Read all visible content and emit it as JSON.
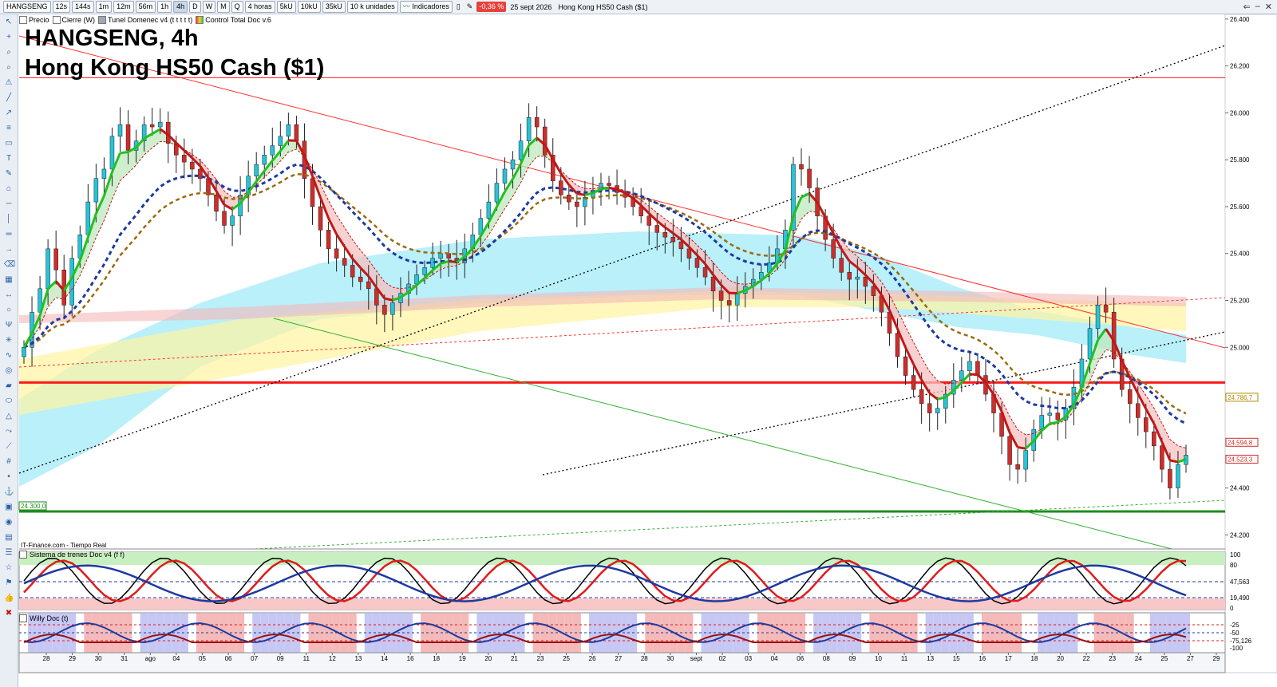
{
  "toolbar": {
    "symbol": "HANGSENG",
    "timeframes": [
      "12s",
      "144s",
      "1m",
      "12m",
      "56m",
      "1h",
      "4h",
      "D",
      "W",
      "M",
      "Q"
    ],
    "active_timeframe": "4h",
    "period": "4 horas",
    "vol_buttons": [
      "5kU",
      "10kU",
      "35kU"
    ],
    "units": "10 k unidades",
    "indicators": "Indicadores",
    "change_pct": "-0,36 %",
    "date": "25 sept 2026",
    "instrument": "Hong Kong HS50 Cash ($1)"
  },
  "subtoolbar": [
    "Precio",
    "Cierre (W)",
    "Tunel Domenec v4 (t t t t t)",
    "Control Total Doc v.6"
  ],
  "titles": {
    "line1": "HANGSENG, 4h",
    "line2": "Hong Kong HS50 Cash ($1)"
  },
  "source": "IT-Finance.com - Tiempo Real",
  "panels": {
    "osc1": "Sistema de trenes Doc v4 (f f)",
    "osc2": "Willy Doc (t)"
  },
  "colors": {
    "up_candle": "#25c4d8",
    "down_candle": "#ce2d2a",
    "resistance": "#ff1a1a",
    "support": "#1e8a1e",
    "fast_green": "#22c020",
    "slow_blue": "#1e3aa0",
    "brown": "#9a6a10"
  },
  "chart_data": {
    "type": "candlestick",
    "title": "HANGSENG, 4h",
    "subtitle": "Hong Kong HS50 Cash ($1)",
    "ylim": [
      24140,
      26420
    ],
    "y_ticks": [
      "26.400",
      "26.200",
      "26.000",
      "25.800",
      "25.600",
      "25.400",
      "25.200",
      "25.000",
      "24.400",
      "24.200"
    ],
    "x_ticks": [
      "28",
      "29",
      "30",
      "31",
      "ago",
      "04",
      "05",
      "06",
      "07",
      "09",
      "11",
      "12",
      "13",
      "14",
      "16",
      "18",
      "19",
      "20",
      "21",
      "23",
      "25",
      "26",
      "27",
      "28",
      "30",
      "sept",
      "02",
      "03",
      "04",
      "06",
      "08",
      "09",
      "10",
      "11",
      "13",
      "15",
      "16",
      "17",
      "18",
      "20",
      "22",
      "23",
      "24",
      "25",
      "27",
      "29"
    ],
    "price_labels": [
      {
        "text": "24.786,7",
        "value": 24787,
        "color": "#b58a00"
      },
      {
        "text": "24.594,8",
        "value": 24595,
        "color": "#ce2d2a"
      },
      {
        "text": "24.523,3",
        "value": 24523,
        "color": "#ce2d2a"
      },
      {
        "text": "24.300,0",
        "value": 24300,
        "color": "#1e8a1e"
      }
    ],
    "horizontal_lines": [
      {
        "value": 26150,
        "color": "#ff1a1a",
        "width": 1
      },
      {
        "value": 24850,
        "color": "#ff1a1a",
        "width": 3
      },
      {
        "value": 24300,
        "color": "#1e8a1e",
        "width": 3
      }
    ],
    "close_series": [
      25000,
      25150,
      25250,
      25420,
      25330,
      25180,
      25380,
      25480,
      25620,
      25720,
      25760,
      25900,
      25950,
      25840,
      25880,
      25950,
      25940,
      25960,
      25870,
      25820,
      25790,
      25760,
      25720,
      25650,
      25580,
      25520,
      25560,
      25650,
      25730,
      25780,
      25820,
      25860,
      25900,
      25950,
      25880,
      25720,
      25600,
      25500,
      25420,
      25380,
      25350,
      25300,
      25280,
      25250,
      25180,
      25140,
      25190,
      25230,
      25270,
      25310,
      25340,
      25380,
      25400,
      25380,
      25360,
      25420,
      25480,
      25550,
      25620,
      25700,
      25760,
      25800,
      25880,
      25980,
      25940,
      25820,
      25710,
      25650,
      25620,
      25600,
      25640,
      25670,
      25700,
      25690,
      25660,
      25640,
      25600,
      25560,
      25520,
      25490,
      25470,
      25450,
      25420,
      25380,
      25340,
      25300,
      25240,
      25200,
      25180,
      25230,
      25260,
      25290,
      25320,
      25360,
      25420,
      25500,
      25780,
      25760,
      25680,
      25560,
      25460,
      25380,
      25320,
      25290,
      25300,
      25260,
      25220,
      25150,
      25060,
      24960,
      24880,
      24820,
      24760,
      24720,
      24740,
      24800,
      24860,
      24900,
      24940,
      24880,
      24800,
      24720,
      24620,
      24500,
      24480,
      24560,
      24650,
      24710,
      24720,
      24690,
      24740,
      24830,
      24950,
      25080,
      25180,
      25150,
      24950,
      24820,
      24760,
      24700,
      24640,
      24580,
      24480,
      24400,
      24500,
      24540
    ],
    "series": [
      {
        "name": "Tunel Domenec v4",
        "type": "line"
      },
      {
        "name": "Control Total Doc v.6",
        "type": "line"
      }
    ],
    "osc1": {
      "ylim": [
        0,
        100
      ],
      "ticks": [
        "100",
        "80",
        "47,563",
        "19,490",
        "0"
      ]
    },
    "osc2": {
      "ticks": [
        "-25",
        "-50",
        "-75,126",
        "-100"
      ]
    }
  }
}
